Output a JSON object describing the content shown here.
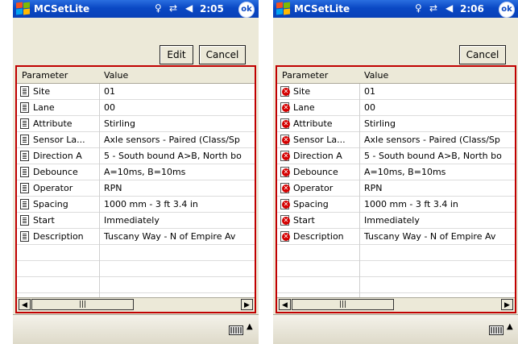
{
  "screens": [
    {
      "app_title": "MCSetLite",
      "time": "2:05",
      "ok_label": "ok",
      "buttons": {
        "edit": "Edit",
        "cancel": "Cancel"
      },
      "columns": {
        "parameter": "Parameter",
        "value": "Value"
      },
      "row_status_icon": "document-icon",
      "rows": [
        {
          "parameter": "Site",
          "value": "01"
        },
        {
          "parameter": "Lane",
          "value": "00"
        },
        {
          "parameter": "Attribute",
          "value": "Stirling"
        },
        {
          "parameter": "Sensor La...",
          "value": "Axle sensors - Paired (Class/Sp"
        },
        {
          "parameter": "Direction A",
          "value": "5 - South bound A>B, North bo"
        },
        {
          "parameter": "Debounce",
          "value": "A=10ms, B=10ms"
        },
        {
          "parameter": "Operator",
          "value": "RPN"
        },
        {
          "parameter": "Spacing",
          "value": "1000 mm - 3 ft 3.4 in"
        },
        {
          "parameter": "Start",
          "value": "Immediately"
        },
        {
          "parameter": "Description",
          "value": "Tuscany Way - N of Empire Av"
        }
      ]
    },
    {
      "app_title": "MCSetLite",
      "time": "2:06",
      "ok_label": "ok",
      "buttons": {
        "cancel": "Cancel"
      },
      "columns": {
        "parameter": "Parameter",
        "value": "Value"
      },
      "row_status_icon": "error-icon",
      "rows": [
        {
          "parameter": "Site",
          "value": "01"
        },
        {
          "parameter": "Lane",
          "value": "00"
        },
        {
          "parameter": "Attribute",
          "value": "Stirling"
        },
        {
          "parameter": "Sensor La...",
          "value": "Axle sensors - Paired (Class/Sp"
        },
        {
          "parameter": "Direction A",
          "value": "5 - South bound A>B, North bo"
        },
        {
          "parameter": "Debounce",
          "value": "A=10ms, B=10ms"
        },
        {
          "parameter": "Operator",
          "value": "RPN"
        },
        {
          "parameter": "Spacing",
          "value": "1000 mm - 3 ft 3.4 in"
        },
        {
          "parameter": "Start",
          "value": "Immediately"
        },
        {
          "parameter": "Description",
          "value": "Tuscany Way - N of Empire Av"
        }
      ]
    }
  ],
  "colors": {
    "titlebar": "#0a48c4",
    "grid_border": "#c00000",
    "error_icon": "#d40000",
    "chrome": "#ece9d8"
  }
}
